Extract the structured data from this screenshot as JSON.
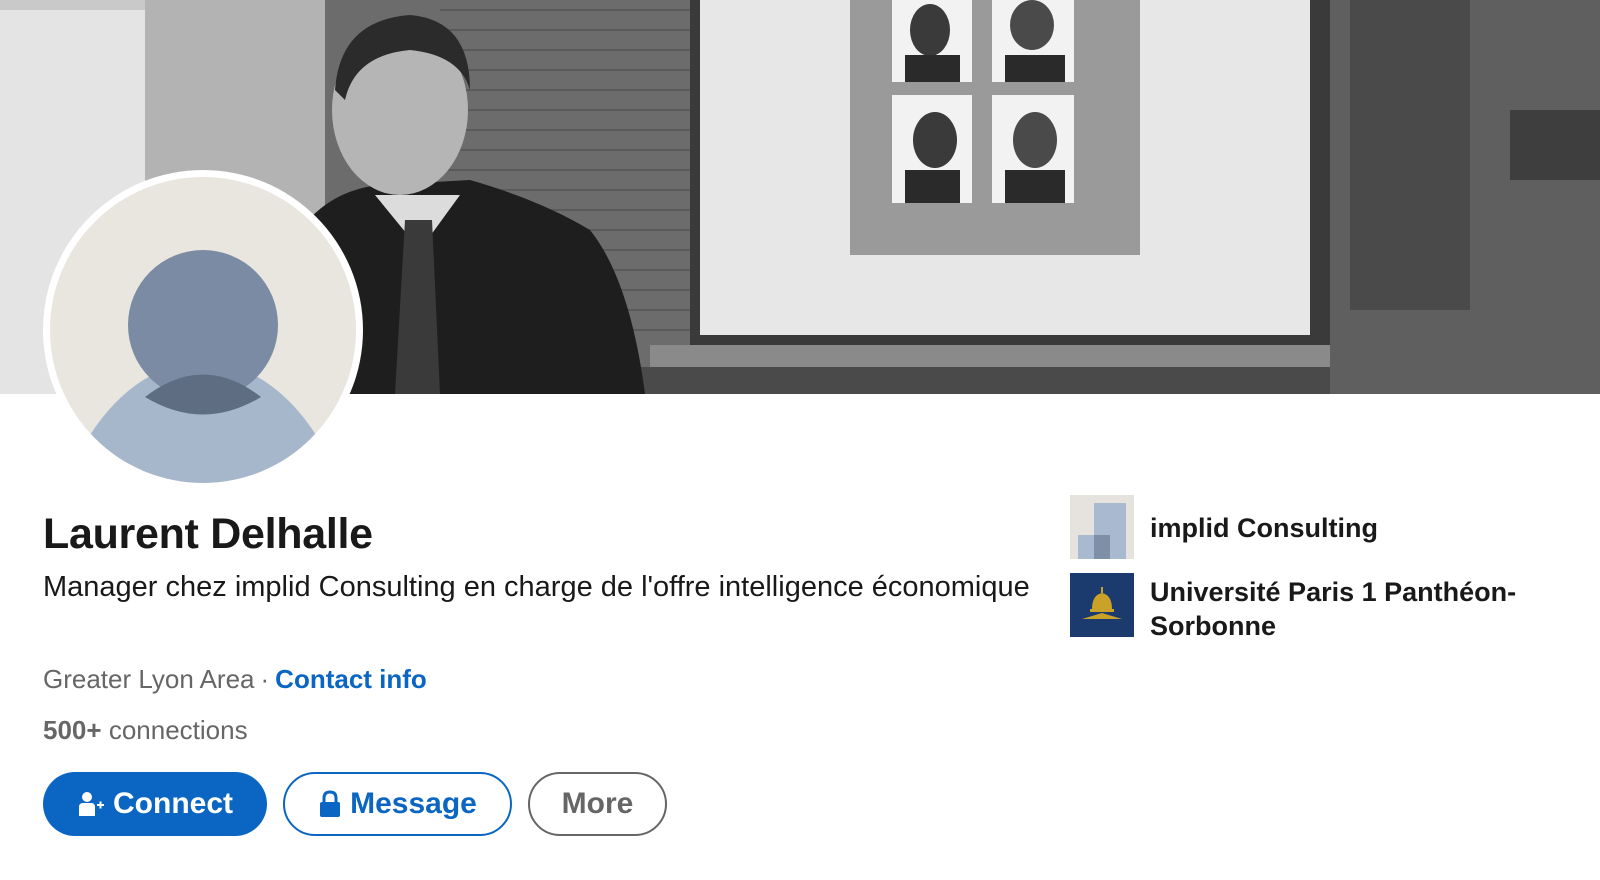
{
  "profile": {
    "name": "Laurent Delhalle",
    "headline": "Manager chez implid Consulting en charge de l'offre intelligence économique",
    "location": "Greater Lyon Area",
    "separator": "·",
    "contact_info_label": "Contact info",
    "connections_count": "500+",
    "connections_label": "connections"
  },
  "actions": {
    "connect_label": "Connect",
    "message_label": "Message",
    "more_label": "More"
  },
  "organizations": [
    {
      "name": "implid Consulting",
      "logo": "implid-logo-icon"
    },
    {
      "name": "Université Paris 1 Panthéon-Sorbonne",
      "logo": "pantheon-dome-logo-icon"
    }
  ],
  "icons": {
    "connect": "add-person-icon",
    "message": "lock-icon",
    "avatar": "default-person-avatar-icon"
  },
  "colors": {
    "accent": "#0a66c2",
    "text_primary": "#191919",
    "text_secondary": "#666666",
    "avatar_bg": "#e9e5df",
    "avatar_figure": "#7a8ba3",
    "sorbonne_blue": "#1b3a6e",
    "sorbonne_gold": "#c9a227"
  }
}
